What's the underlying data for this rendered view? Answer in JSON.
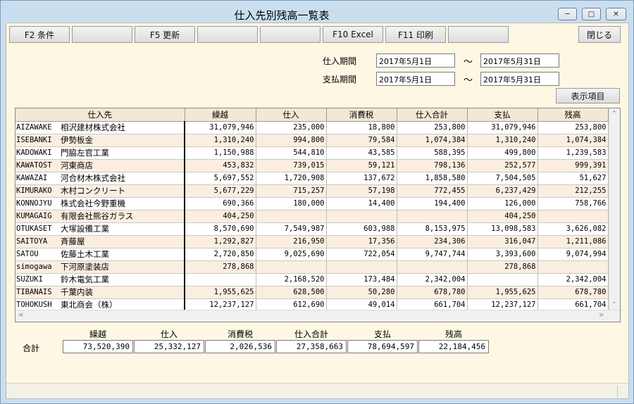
{
  "window": {
    "title": "仕入先別残高一覧表",
    "controls": [
      "minimize-icon",
      "maximize-icon",
      "close-icon"
    ]
  },
  "toolbar": {
    "f2": "F2 条件",
    "f5": "F5 更新",
    "f10": "F10 Excel",
    "f11": "F11 印刷",
    "close": "閉じる"
  },
  "filters": {
    "purchase_period_label": "仕入期間",
    "purchase_from": "2017年5月1日",
    "purchase_to": "2017年5月31日",
    "payment_period_label": "支払期間",
    "payment_from": "2017年5月1日",
    "payment_to": "2017年5月31日",
    "tilde": "～",
    "display_items_button": "表示項目"
  },
  "table": {
    "headers": [
      "仕入先",
      "繰越",
      "仕入",
      "消費税",
      "仕入合計",
      "支払",
      "残高"
    ],
    "rows": [
      {
        "code": "AIZAWAKE",
        "name": "相沢建材株式会社",
        "kurikoshi": "31,079,946",
        "shiire": "235,000",
        "tax": "18,800",
        "total": "253,800",
        "shiharai": "31,079,946",
        "zandaka": "253,800"
      },
      {
        "code": "ISEBANKI",
        "name": "伊勢板金",
        "kurikoshi": "1,310,240",
        "shiire": "994,800",
        "tax": "79,584",
        "total": "1,074,384",
        "shiharai": "1,310,240",
        "zandaka": "1,074,384"
      },
      {
        "code": "KADOWAKI",
        "name": "門脇左官工業",
        "kurikoshi": "1,150,988",
        "shiire": "544,810",
        "tax": "43,585",
        "total": "588,395",
        "shiharai": "499,800",
        "zandaka": "1,239,583"
      },
      {
        "code": "KAWATOST",
        "name": "河東商店",
        "kurikoshi": "453,832",
        "shiire": "739,015",
        "tax": "59,121",
        "total": "798,136",
        "shiharai": "252,577",
        "zandaka": "999,391"
      },
      {
        "code": "KAWAZAI",
        "name": "河合材木株式会社",
        "kurikoshi": "5,697,552",
        "shiire": "1,720,908",
        "tax": "137,672",
        "total": "1,858,580",
        "shiharai": "7,504,505",
        "zandaka": "51,627"
      },
      {
        "code": "KIMURAKO",
        "name": "木村コンクリート",
        "kurikoshi": "5,677,229",
        "shiire": "715,257",
        "tax": "57,198",
        "total": "772,455",
        "shiharai": "6,237,429",
        "zandaka": "212,255"
      },
      {
        "code": "KONNOJYU",
        "name": "株式会社今野重機",
        "kurikoshi": "690,366",
        "shiire": "180,000",
        "tax": "14,400",
        "total": "194,400",
        "shiharai": "126,000",
        "zandaka": "758,766"
      },
      {
        "code": "KUMAGAIG",
        "name": "有限会社熊谷ガラス",
        "kurikoshi": "404,250",
        "shiire": "",
        "tax": "",
        "total": "",
        "shiharai": "404,250",
        "zandaka": ""
      },
      {
        "code": "OTUKASET",
        "name": "大塚設備工業",
        "kurikoshi": "8,570,690",
        "shiire": "7,549,987",
        "tax": "603,988",
        "total": "8,153,975",
        "shiharai": "13,098,583",
        "zandaka": "3,626,082"
      },
      {
        "code": "SAITOYA",
        "name": "斉藤屋",
        "kurikoshi": "1,292,827",
        "shiire": "216,950",
        "tax": "17,356",
        "total": "234,306",
        "shiharai": "316,047",
        "zandaka": "1,211,086"
      },
      {
        "code": "SATOU",
        "name": "佐藤土木工業",
        "kurikoshi": "2,720,850",
        "shiire": "9,025,690",
        "tax": "722,054",
        "total": "9,747,744",
        "shiharai": "3,393,600",
        "zandaka": "9,074,994"
      },
      {
        "code": "simogawa",
        "name": "下河原塗装店",
        "kurikoshi": "278,868",
        "shiire": "",
        "tax": "",
        "total": "",
        "shiharai": "278,868",
        "zandaka": ""
      },
      {
        "code": "SUZUKI",
        "name": "鈴木電気工業",
        "kurikoshi": "",
        "shiire": "2,168,520",
        "tax": "173,484",
        "total": "2,342,004",
        "shiharai": "",
        "zandaka": "2,342,004"
      },
      {
        "code": "TIBANAIS",
        "name": "千葉内装",
        "kurikoshi": "1,955,625",
        "shiire": "628,500",
        "tax": "50,280",
        "total": "678,780",
        "shiharai": "1,955,625",
        "zandaka": "678,780"
      },
      {
        "code": "TOHOKUSH",
        "name": "東北商会（株）",
        "kurikoshi": "12,237,127",
        "shiire": "612,690",
        "tax": "49,014",
        "total": "661,704",
        "shiharai": "12,237,127",
        "zandaka": "661,704"
      }
    ]
  },
  "totals": {
    "label": "合計",
    "headers": [
      "繰越",
      "仕入",
      "消費税",
      "仕入合計",
      "支払",
      "残高"
    ],
    "values": [
      "73,520,390",
      "25,332,127",
      "2,026,536",
      "27,358,663",
      "78,694,597",
      "22,184,456"
    ]
  },
  "colors": {
    "client_bg": "#fdf7e3",
    "row_alt": "#fbeee0",
    "header_bg": "#f4e7d3",
    "frame": "#c9dff0"
  }
}
